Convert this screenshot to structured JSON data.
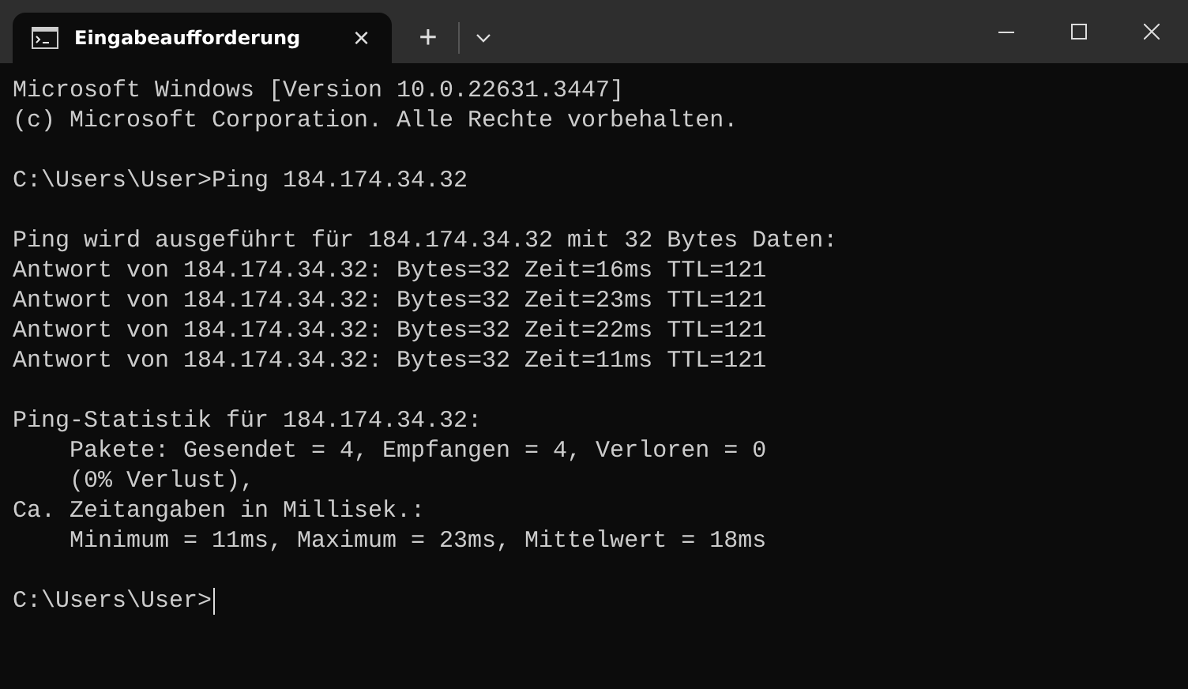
{
  "tabs": [
    {
      "title": "Eingabeaufforderung",
      "close": "×",
      "selected": true
    }
  ],
  "new_tab": "+",
  "terminal": {
    "blocks": [
      {
        "lines": [
          "Microsoft Windows [Version 10.0.22631.3447]",
          "(c) Microsoft Corporation. Alle Rechte vorbehalten."
        ]
      },
      {
        "lines": [
          "C:\\Users\\User>Ping 184.174.34.32"
        ]
      },
      {
        "lines": [
          "Ping wird ausgeführt für 184.174.34.32 mit 32 Bytes Daten:",
          "Antwort von 184.174.34.32: Bytes=32 Zeit=16ms TTL=121",
          "Antwort von 184.174.34.32: Bytes=32 Zeit=23ms TTL=121",
          "Antwort von 184.174.34.32: Bytes=32 Zeit=22ms TTL=121",
          "Antwort von 184.174.34.32: Bytes=32 Zeit=11ms TTL=121"
        ]
      },
      {
        "lines": [
          "Ping-Statistik für 184.174.34.32:",
          "    Pakete: Gesendet = 4, Empfangen = 4, Verloren = 0",
          "    (0% Verlust),",
          "Ca. Zeitangaben in Millisek.:",
          "    Minimum = 11ms, Maximum = 23ms, Mittelwert = 18ms"
        ]
      }
    ],
    "prompt": "C:\\Users\\User>"
  }
}
